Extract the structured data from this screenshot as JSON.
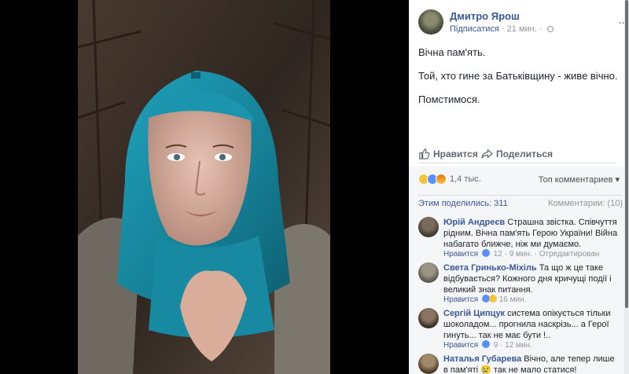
{
  "post": {
    "author": "Дмитро Ярош",
    "follow": "Підписатися",
    "time": "· 21 мин. ·",
    "more": "···",
    "lines": [
      "Вічна пам'ять.",
      "Той, хто гине за Батьківщину - живе вічно.",
      "Помстимося."
    ]
  },
  "actions": {
    "like": "Нравится",
    "share": "Поделиться"
  },
  "stats": {
    "reactions_count": "1,4 тыс.",
    "sort": "Топ комментариев ▾",
    "shares": "Этим поделились: 311",
    "comments": "Комментарии: (10)"
  },
  "comments": [
    {
      "name": "Юрій Андреєв",
      "text": "Страшна звістка. Співчуття рідним. Вічна пам'ять Герою України! Війна набагато ближче, ніж ми думаємо.",
      "like": "Нравится",
      "count": "12",
      "time": "· 9 мин. · Отредактирован"
    },
    {
      "name": "Света Гринько-Міхіль",
      "text": "Та що ж це таке відбувається? Кожного дня кричущі події і великий знак питання.",
      "like": "Нравится",
      "count": "16 мин.",
      "time": ""
    },
    {
      "name": "Сергій Ципцук",
      "text": "система опікується тільки шоколадом... прогнила наскрізь... а Герої гинуть... так не має бути !..",
      "like": "Нравится",
      "count": "9",
      "time": "· 12 мин."
    },
    {
      "name": "Наталья Губарева",
      "text": "Вічно, але тепер лише в пам'яті 😢 так не мало статися!",
      "like": "",
      "count": "",
      "time": ""
    }
  ],
  "colors": {
    "link": "#385898",
    "muted": "#90949c",
    "hijab": "#1a8ea6"
  }
}
